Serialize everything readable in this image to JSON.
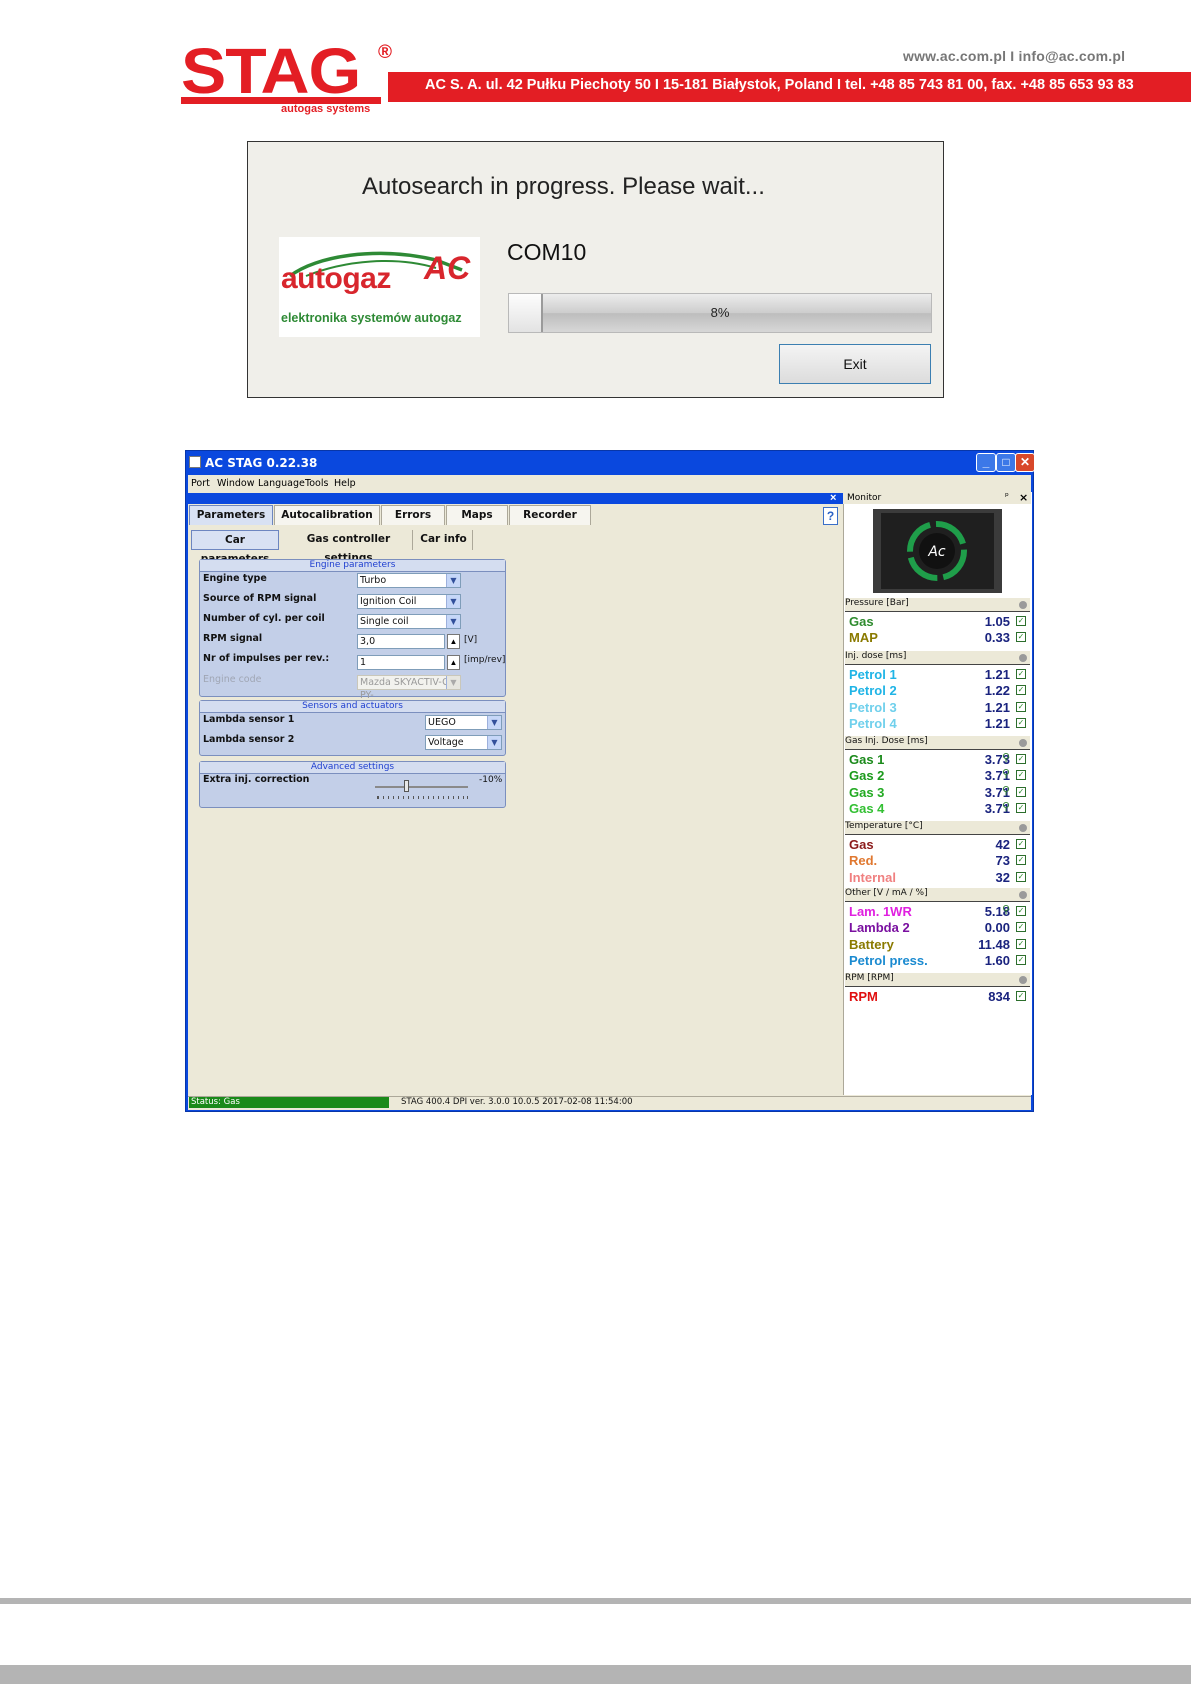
{
  "letterhead": {
    "logo": "STAG",
    "registered": "®",
    "logo_sub": "autogas systems",
    "web": "www.ac.com.pl I info@ac.com.pl",
    "address": "AC S. A. ul. 42 Pułku Piechoty 50 I 15-181 Białystok, Poland I tel. +48 85 743 81 00, fax. +48 85 653 93 83"
  },
  "autosearch": {
    "title": "Autosearch in progress. Please wait...",
    "brand_name": "autogaz",
    "brand_ac": "AC",
    "brand_sub": "elektronika systemów autogaz",
    "port": "COM10",
    "progress": 0.08,
    "progress_label": "8%",
    "exit_label": "Exit"
  },
  "app": {
    "title": "AC STAG 0.22.38",
    "menu": [
      "Port",
      "Window",
      "Language",
      "Tools",
      "Help"
    ],
    "tabs": [
      "Parameters",
      "Autocalibration",
      "Errors",
      "Maps",
      "Recorder"
    ],
    "subtabs": [
      "Car parameters",
      "Gas controller settings",
      "Car info"
    ],
    "engine_group": {
      "title": "Engine parameters",
      "rows": [
        {
          "label": "Engine type",
          "value": "Turbo"
        },
        {
          "label": "Source of RPM signal",
          "value": "Ignition Coil"
        },
        {
          "label": "Number of cyl. per coil",
          "value": "Single coil"
        },
        {
          "label": "RPM signal",
          "value": "3,0",
          "unit": "[V]"
        },
        {
          "label": "Nr of impulses per rev.:",
          "value": "1",
          "unit": "[imp/rev]"
        },
        {
          "label": "Engine code",
          "value": "Mazda SKYACTIV-G PY-"
        }
      ]
    },
    "sensors_group": {
      "title": "Sensors and actuators",
      "rows": [
        {
          "label": "Lambda sensor 1",
          "value": "UEGO"
        },
        {
          "label": "Lambda sensor 2",
          "value": "Voltage"
        }
      ]
    },
    "advanced_group": {
      "title": "Advanced settings",
      "label": "Extra inj. correction",
      "value": "-10%"
    },
    "status": "Status: Gas",
    "status_info": "STAG 400.4 DPI  ver. 3.0.0  10.0.5   2017-02-08 11:54:00",
    "monitor": {
      "title": "Monitor",
      "sections": [
        {
          "title": "Pressure [Bar]",
          "rows": [
            {
              "name": "Gas",
              "value": "1.05",
              "color": "#2e8b2e"
            },
            {
              "name": "MAP",
              "value": "0.33",
              "color": "#8a7a00"
            }
          ]
        },
        {
          "title": "Inj. dose [ms]",
          "rows": [
            {
              "name": "Petrol 1",
              "value": "1.21",
              "color": "#1fb4e6"
            },
            {
              "name": "Petrol 2",
              "value": "1.22",
              "color": "#1fb4e6"
            },
            {
              "name": "Petrol 3",
              "value": "1.21",
              "color": "#6fd0ec"
            },
            {
              "name": "Petrol 4",
              "value": "1.21",
              "color": "#6fd0ec"
            }
          ]
        },
        {
          "title": "Gas Inj. Dose [ms]",
          "rows": [
            {
              "name": "Gas 1",
              "value": "3.73",
              "color": "#1b8a1b"
            },
            {
              "name": "Gas 2",
              "value": "3.71",
              "color": "#1b9a1b"
            },
            {
              "name": "Gas 3",
              "value": "3.71",
              "color": "#22aa22"
            },
            {
              "name": "Gas 4",
              "value": "3.71",
              "color": "#33c033"
            }
          ]
        },
        {
          "title": "Temperature [°C]",
          "rows": [
            {
              "name": "Gas",
              "value": "42",
              "color": "#8b1a1a"
            },
            {
              "name": "Red.",
              "value": "73",
              "color": "#e07830"
            },
            {
              "name": "Internal",
              "value": "32",
              "color": "#f08080"
            }
          ]
        },
        {
          "title": "Other [V / mA / %]",
          "rows": [
            {
              "name": "Lam. 1WR",
              "value": "5.18",
              "color": "#e020e0"
            },
            {
              "name": "Lambda 2",
              "value": "0.00",
              "color": "#7a10a0"
            },
            {
              "name": "Battery",
              "value": "11.48",
              "color": "#8a7a00"
            },
            {
              "name": "Petrol press.",
              "value": "1.60",
              "color": "#1a8ad0"
            }
          ]
        },
        {
          "title": "RPM [RPM]",
          "rows": [
            {
              "name": "RPM",
              "value": "834",
              "color": "#e01010"
            }
          ]
        }
      ]
    }
  }
}
